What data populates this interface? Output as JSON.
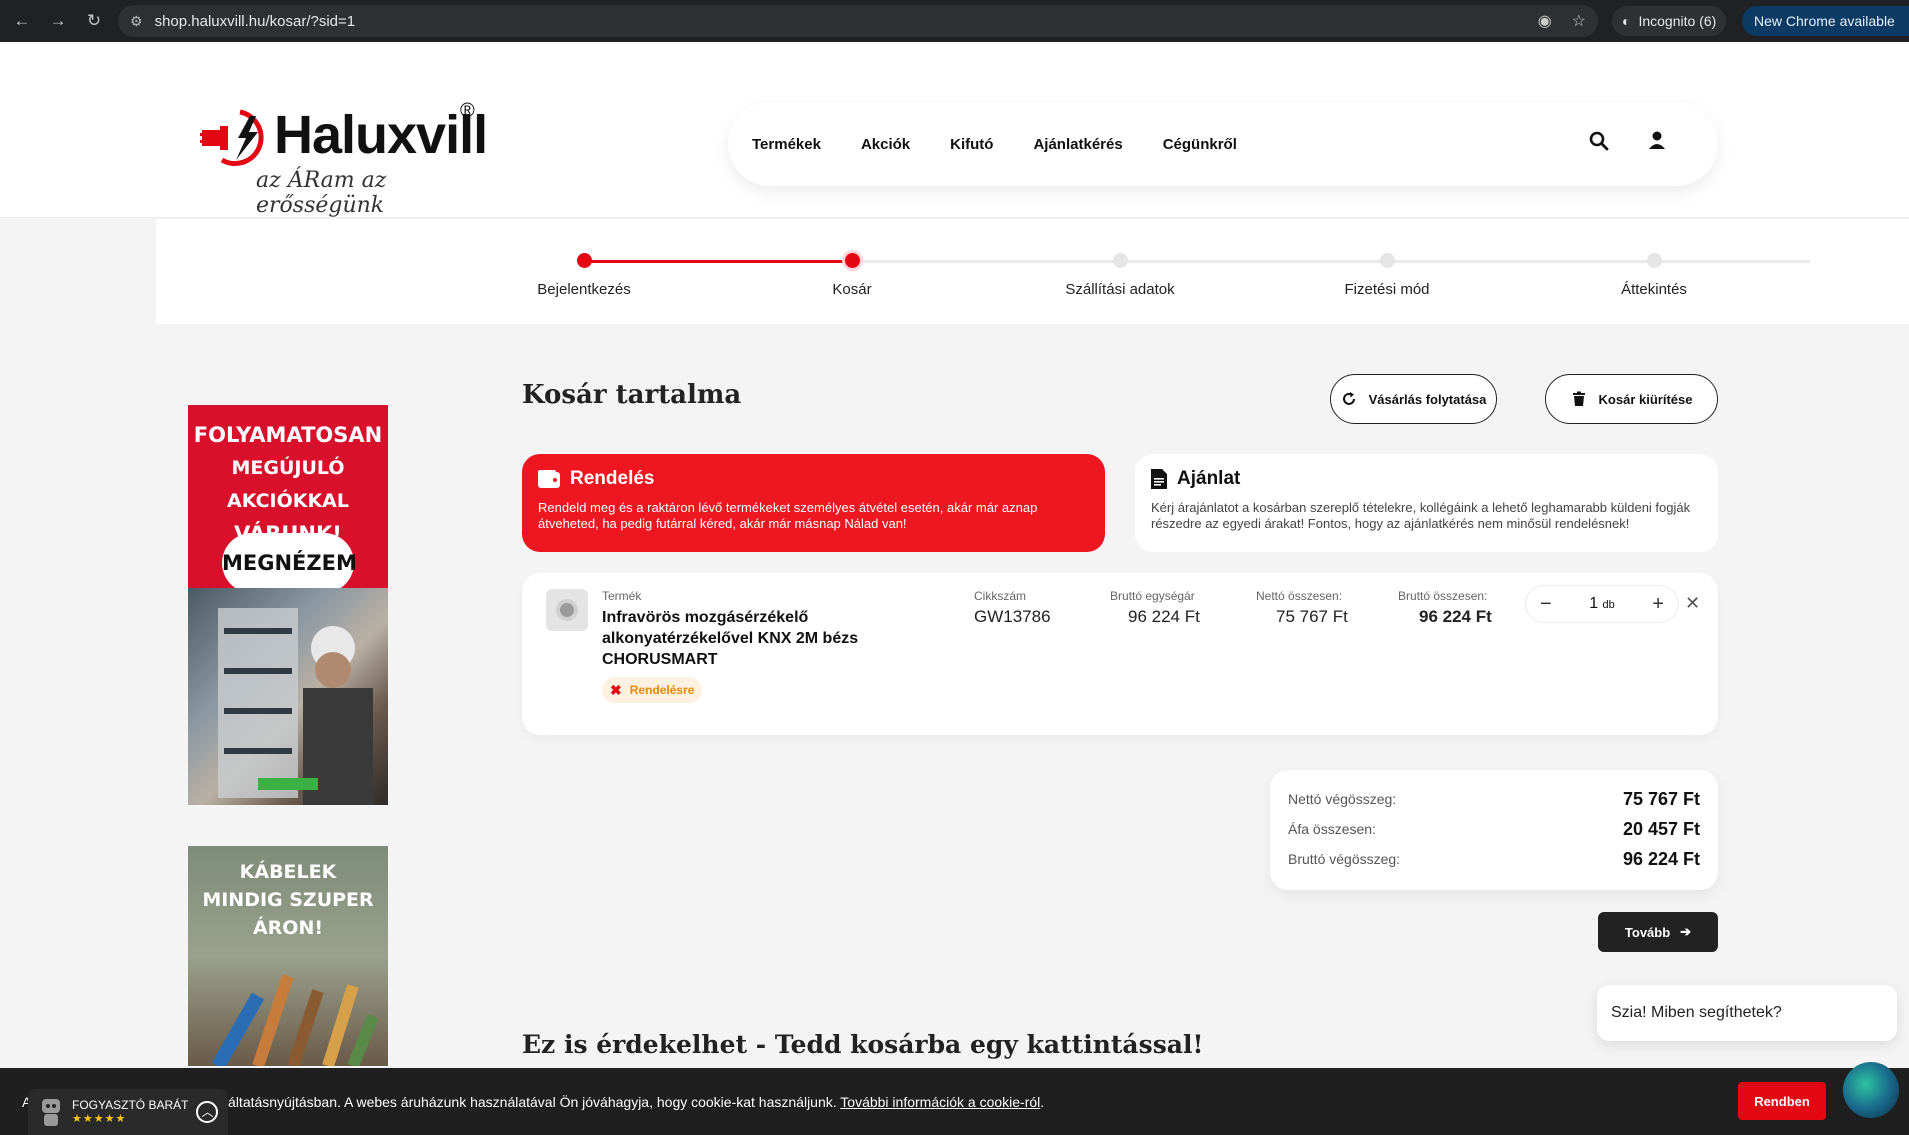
{
  "browser": {
    "url": "shop.haluxvill.hu/kosar/?sid=1",
    "incognito_label": "Incognito (6)",
    "new_chrome_label": "New Chrome available"
  },
  "header": {
    "brand": "Haluxvill",
    "registered": "®",
    "slogan": "az ÁRam az erősségünk",
    "nav": [
      "Termékek",
      "Akciók",
      "Kifutó",
      "Ajánlatkérés",
      "Cégünkről"
    ]
  },
  "steps": {
    "items": [
      {
        "label": "Bejelentkezés",
        "state": "done"
      },
      {
        "label": "Kosár",
        "state": "active"
      },
      {
        "label": "Szállítási adatok",
        "state": "todo"
      },
      {
        "label": "Fizetési mód",
        "state": "todo"
      },
      {
        "label": "Áttekintés",
        "state": "todo"
      }
    ]
  },
  "banners": {
    "banner1_text": "FOLYAMATOSAN MEGÚJULÓ AKCIÓKKAL VÁRUNK!",
    "banner1_line1": "FOLYAMATOSAN",
    "banner1_line2": "MEGÚJULÓ AKCIÓKKAL",
    "banner1_line3": "VÁRUNK!",
    "banner1_cta": "MEGNÉZEM",
    "banner2_line1": "KÁBELEK",
    "banner2_line2": "MINDIG SZUPER",
    "banner2_line3": "ÁRON!"
  },
  "cart": {
    "title": "Kosár tartalma",
    "continue_label": "Vásárlás folytatása",
    "empty_label": "Kosár kiürítése",
    "order_card": {
      "title": "Rendelés",
      "text": "Rendeld meg és a raktáron lévő termékeket személyes átvétel esetén, akár már aznap átveheted, ha pedig futárral kéred, akár már másnap Nálad van!"
    },
    "offer_card": {
      "title": "Ajánlat",
      "text": "Kérj árajánlatot a kosárban szereplő tételekre, kollégáink a lehető leghamarabb küldeni fogják részedre az egyedi árakat! Fontos, hogy az ajánlatkérés nem minősül rendelésnek!"
    },
    "item": {
      "product_label": "Termék",
      "product_name": "Infravörös mozgásérzékelő alkonyatérzékelővel KNX 2M bézs CHORUSMART",
      "badge": "Rendelésre",
      "sku_label": "Cikkszám",
      "sku": "GW13786",
      "unit_price_label": "Bruttó egységár",
      "unit_price": "96 224 Ft",
      "net_total_label": "Nettó összesen:",
      "net_total": "75 767 Ft",
      "gross_total_label": "Bruttó összesen:",
      "gross_total": "96 224 Ft",
      "qty": "1",
      "qty_unit": "db",
      "minus": "−",
      "plus": "+",
      "remove": "✕"
    },
    "totals": [
      {
        "label": "Nettó végösszeg:",
        "value": "75 767 Ft"
      },
      {
        "label": "Áfa összesen:",
        "value": "20 457 Ft"
      },
      {
        "label": "Bruttó végösszeg:",
        "value": "96 224 Ft"
      }
    ],
    "next_label": "Tovább"
  },
  "suggest_title": "Ez is érdekelhet - Tedd kosárba egy kattintással!",
  "chat": {
    "bubble": "Szia! Miben segíthetek?"
  },
  "cookie": {
    "text": "olgáltatásnyújtásban. A webes áruházunk használatával Ön jóváhagyja, hogy cookie-kat használjunk. ",
    "prefix": "A",
    "link": "További információk a cookie-ról",
    "suffix": ".",
    "ok": "Rendben",
    "fogy_label": "FOGYASZTÓ BARÁT",
    "fogy_stars": "★★★★★"
  },
  "colors": {
    "brand_red": "#e30613",
    "dark": "#222222"
  }
}
